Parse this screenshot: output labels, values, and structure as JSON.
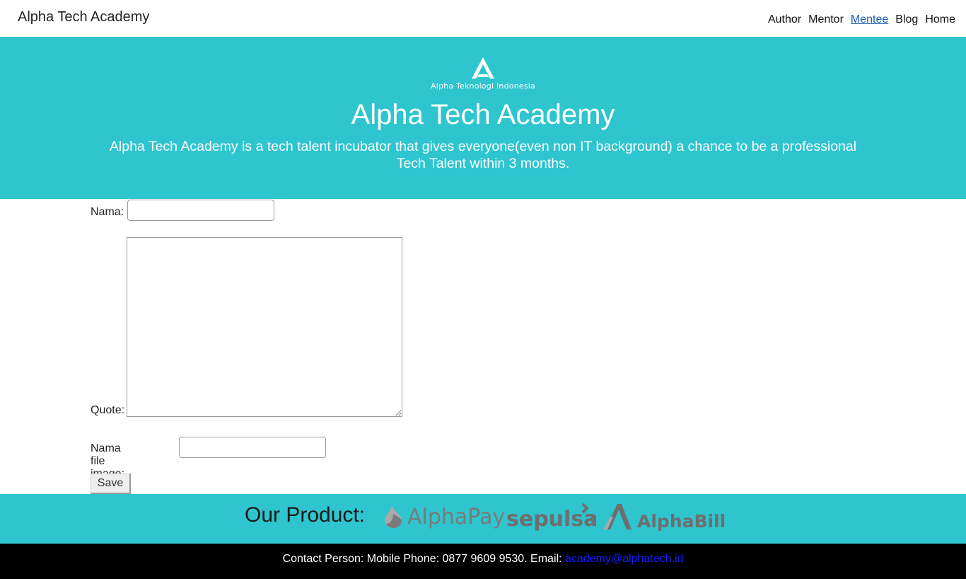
{
  "navbar": {
    "brand": "Alpha Tech Academy",
    "links": [
      {
        "label": "Author",
        "active": false
      },
      {
        "label": "Mentor",
        "active": false
      },
      {
        "label": "Mentee",
        "active": true
      },
      {
        "label": "Blog",
        "active": false
      },
      {
        "label": "Home",
        "active": false
      }
    ]
  },
  "hero": {
    "logo_text": "Alpha Teknologi Indonesia",
    "title": "Alpha Tech Academy",
    "description": "Alpha Tech Academy is a tech talent incubator that gives everyone(even non IT background) a chance to be a professional Tech Talent within 3 months."
  },
  "form": {
    "nama_label": "Nama:",
    "nama_value": "",
    "quote_label": "Quote:",
    "quote_value": "",
    "image_label": "Nama file image:",
    "image_value": "",
    "save_label": "Save"
  },
  "products": {
    "title": "Our Product:",
    "logos": [
      {
        "name": "AlphaPay",
        "icon": "alphapay-logo"
      },
      {
        "name": "sepulsa",
        "icon": "sepulsa-logo"
      },
      {
        "name": "AlphaBill",
        "icon": "alphabill-logo"
      }
    ]
  },
  "footer": {
    "contact_text": "Contact Person: Mobile Phone: 0877 9609 9530. Email:",
    "email": "academy@alphatech.id"
  },
  "colors": {
    "accent": "#2ec5cf",
    "footer_bg": "#000000",
    "link_active": "#1a5fb4",
    "email_link": "#1a1aff"
  }
}
